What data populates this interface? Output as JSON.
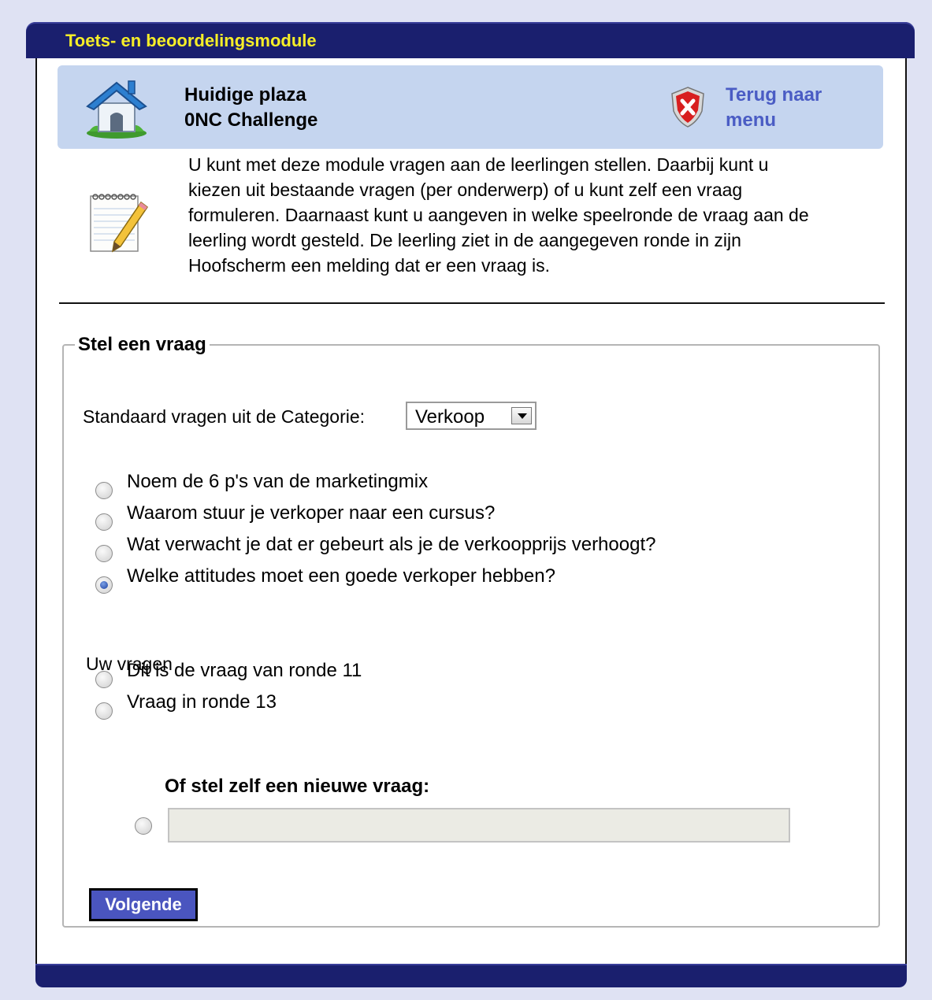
{
  "window": {
    "title": "Toets- en beoordelingsmodule"
  },
  "plaza": {
    "label_line1": "Huidige plaza",
    "label_line2": "0NC Challenge",
    "back_line1": "Terug naar",
    "back_line2": "menu"
  },
  "intro": {
    "lines": [
      "U kunt met deze module vragen aan de leerlingen stellen. Daarbij kunt u",
      "kiezen uit bestaande vragen (per onderwerp) of u kunt zelf een vraag",
      "formuleren. Daarnaast kunt u aangeven in welke speelronde de vraag aan de",
      "leerling wordt gesteld. De leerling ziet in de aangegeven ronde in zijn",
      "Hoofscherm een melding dat er een vraag is."
    ]
  },
  "form": {
    "legend": "Stel een vraag",
    "category_label": "Standaard vragen uit de Categorie:",
    "category_selected": "Verkoop",
    "standard_questions": [
      {
        "label": "Noem de 6 p's van de marketingmix",
        "checked": false
      },
      {
        "label": "Waarom stuur je verkoper naar een cursus?",
        "checked": false
      },
      {
        "label": "Wat verwacht je dat er gebeurt als je de verkoopprijs verhoogt?",
        "checked": false
      },
      {
        "label": "Welke attitudes moet een goede verkoper hebben?",
        "checked": true
      }
    ],
    "own_questions_label": "Uw vragen",
    "own_questions": [
      {
        "label": "Dit is de vraag van ronde 11",
        "checked": false
      },
      {
        "label": "Vraag in ronde 13",
        "checked": false
      }
    ],
    "new_question_label": "Of stel zelf een nieuwe vraag:",
    "new_question_value": "",
    "next_button": "Volgende"
  },
  "colors": {
    "titlebar": "#1a1f6e",
    "title_text": "#f6ee28",
    "plaza_bg": "#c5d5ef",
    "link": "#4a5cc4",
    "button": "#4a55bf",
    "page_bg": "#dfe2f3"
  },
  "icons": {
    "plaza": "house-icon",
    "back": "shield-close-icon",
    "intro": "notepad-pencil-icon"
  }
}
